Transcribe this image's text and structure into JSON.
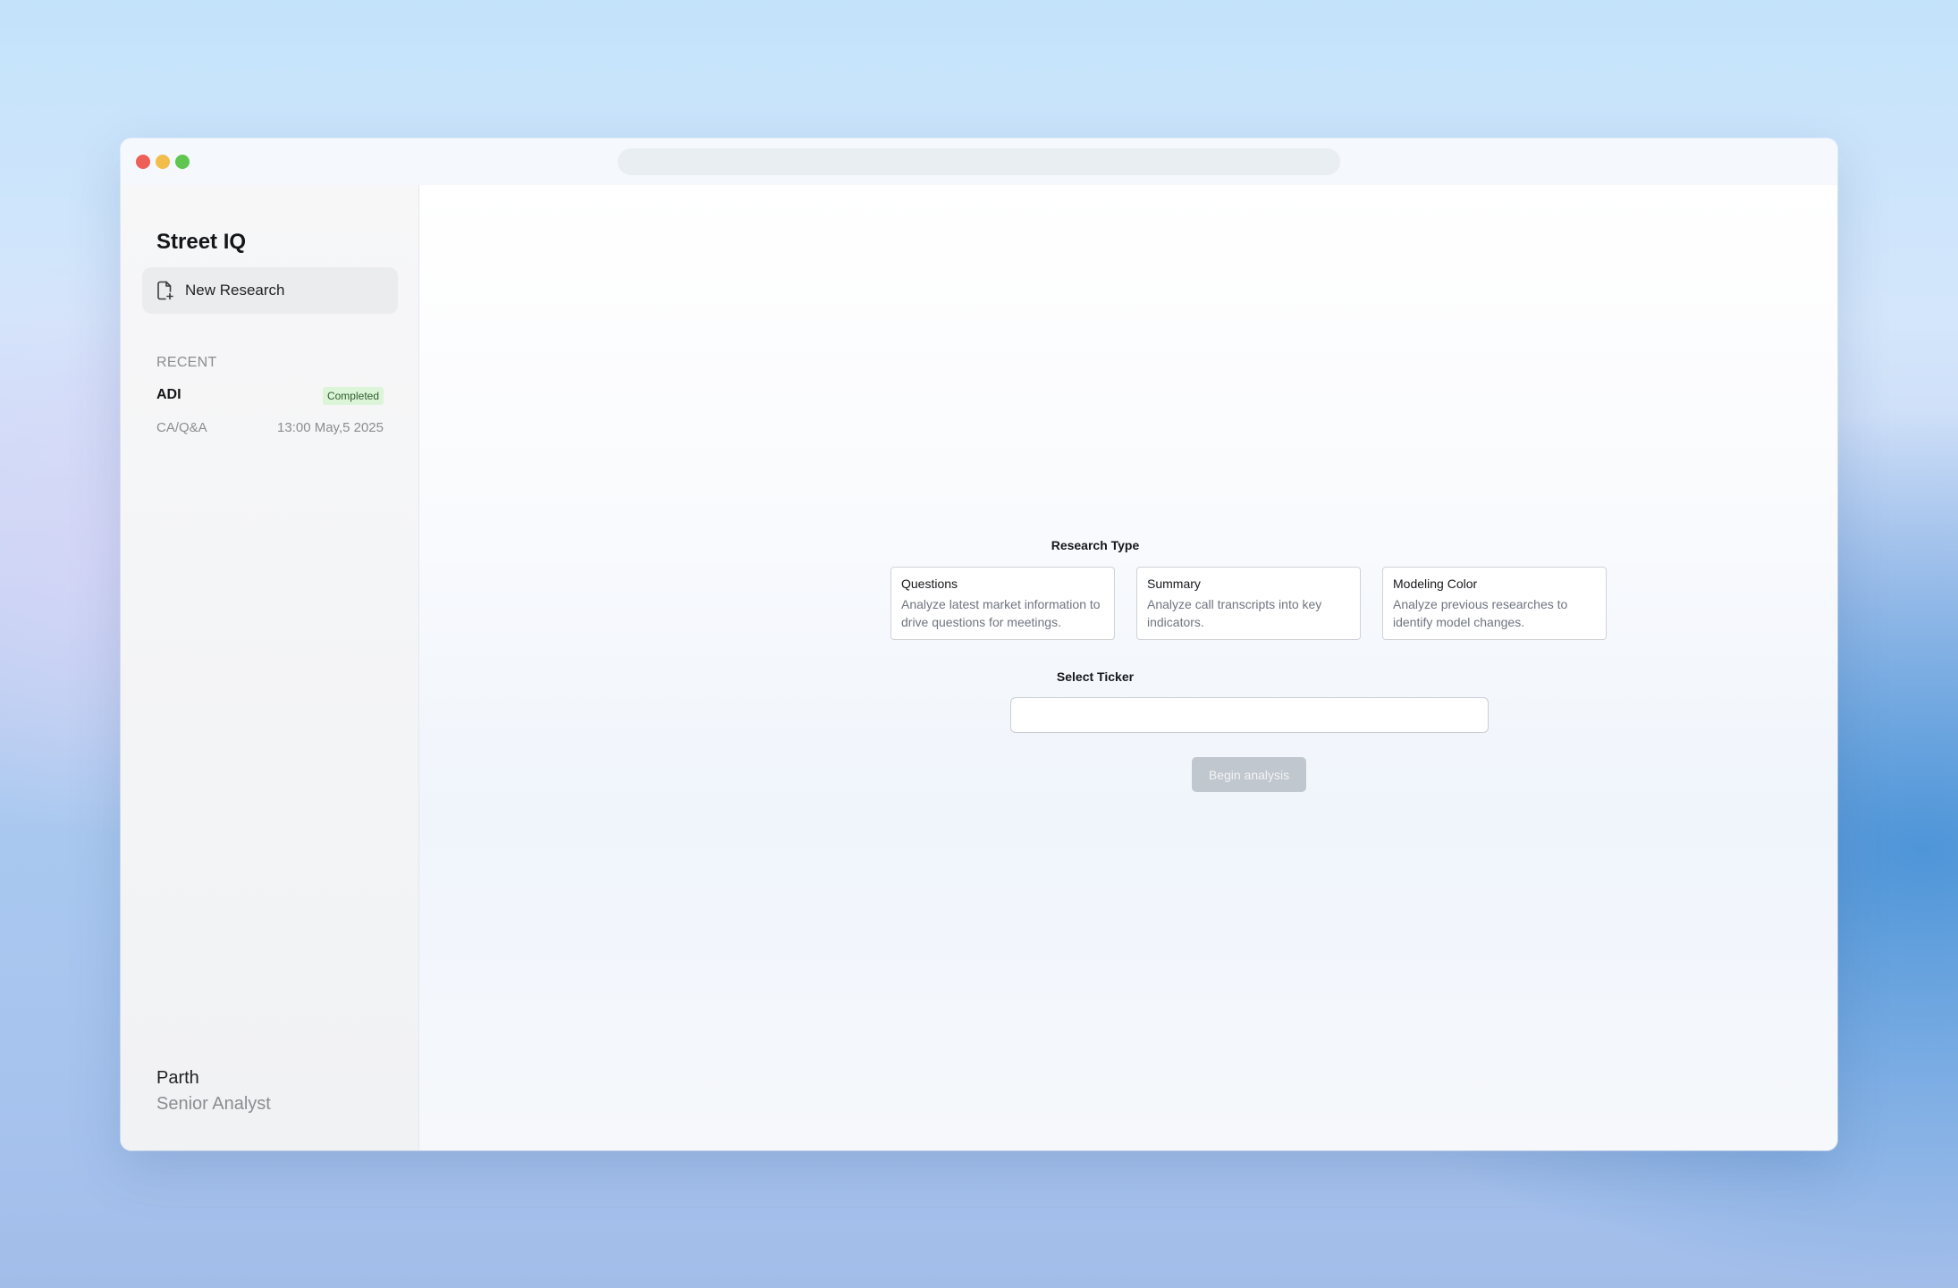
{
  "window": {
    "traffic_lights": [
      "close",
      "minimize",
      "maximize"
    ]
  },
  "sidebar": {
    "brand": "Street IQ",
    "new_research": {
      "label": "New Research",
      "icon": "file-plus-icon"
    },
    "recent_label": "RECENT",
    "recent": [
      {
        "ticker": "ADI",
        "status": "Completed",
        "type": "CA/Q&A",
        "time": "13:00 May,5 2025"
      }
    ],
    "user": {
      "name": "Parth",
      "role": "Senior Analyst"
    }
  },
  "main": {
    "research_type_title": "Research Type",
    "cards": [
      {
        "title": "Questions",
        "description": "Analyze latest market information to drive questions for meetings."
      },
      {
        "title": "Summary",
        "description": "Analyze call transcripts into key indicators."
      },
      {
        "title": "Modeling Color",
        "description": "Analyze previous researches to identify model changes."
      }
    ],
    "select_ticker_title": "Select Ticker",
    "ticker_input": {
      "value": "",
      "placeholder": ""
    },
    "begin_button": "Begin analysis"
  },
  "colors": {
    "badge_bg": "#dcf5d8",
    "badge_text": "#2f5c2c",
    "button_disabled_bg": "#c1c7ce",
    "traffic_red": "#ee5f57",
    "traffic_yellow": "#f2bd4a",
    "traffic_green": "#5fc650"
  }
}
